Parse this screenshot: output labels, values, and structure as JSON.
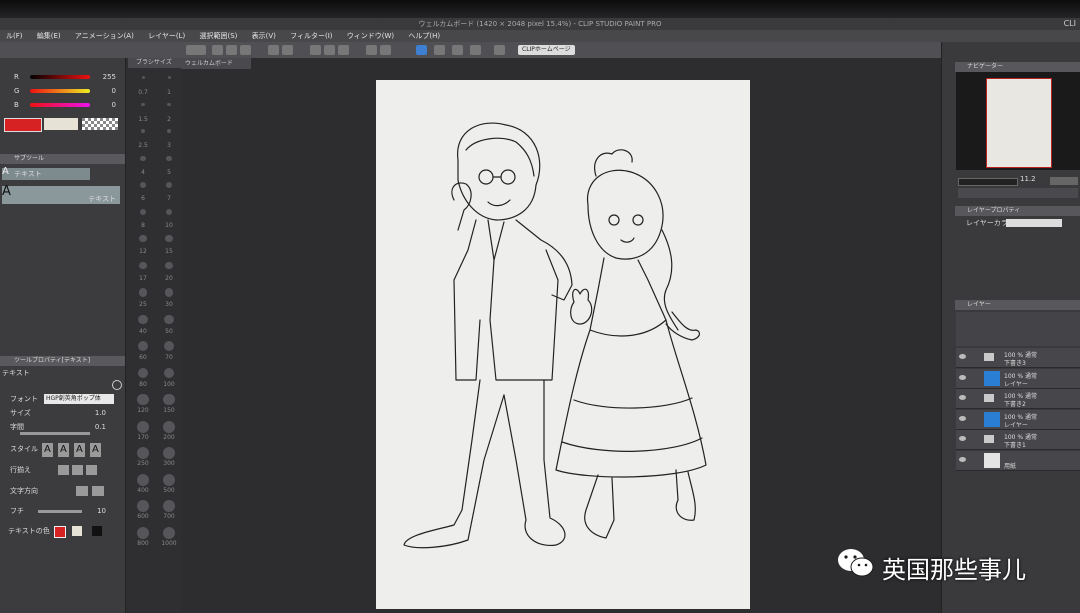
{
  "app": {
    "title": "ウェルカムボード (1420 × 2048 pixel 15.4%) - CLIP STUDIO PAINT PRO",
    "corner_brand": "CLI"
  },
  "menu": [
    "ル(F)",
    "編集(E)",
    "アニメーション(A)",
    "レイヤー(L)",
    "選択範囲(S)",
    "表示(V)",
    "フィルター(I)",
    "ウィンドウ(W)",
    "ヘルプ(H)"
  ],
  "toolbar": {
    "clip_button": "CLIPホームページ"
  },
  "color_panel": {
    "r_label": "R",
    "r_value": "255",
    "g_label": "G",
    "g_value": "0",
    "b_label": "B",
    "b_value": "0",
    "main_color": "#d62222",
    "sub_color": "#e6e2d6"
  },
  "subtool_panel": {
    "header": "サブツール",
    "tab_label": "テキスト",
    "item_label": "テキスト"
  },
  "tool_property": {
    "header": "ツールプロパティ[テキスト]",
    "title": "テキスト",
    "rows": [
      {
        "label": "フォント",
        "value": "HGP創英角ポップ体"
      },
      {
        "label": "サイズ",
        "value": "1.0"
      },
      {
        "label": "字間",
        "value": "0.1"
      },
      {
        "label": "スタイル",
        "value": ""
      },
      {
        "label": "行揃え",
        "value": ""
      },
      {
        "label": "文字方向",
        "value": ""
      },
      {
        "label": "フチ",
        "value": "10"
      },
      {
        "label": "テキストの色",
        "value": ""
      }
    ]
  },
  "swatch_tab": "ブラシサイズ",
  "brush_sizes": [
    "0.7",
    "1",
    "1.5",
    "2",
    "2.5",
    "3",
    "4",
    "5",
    "6",
    "7",
    "8",
    "10",
    "12",
    "15",
    "17",
    "20",
    "25",
    "30",
    "40",
    "50",
    "60",
    "70",
    "80",
    "100",
    "120",
    "150",
    "170",
    "200",
    "250",
    "300",
    "400",
    "500",
    "600",
    "700",
    "800",
    "1000"
  ],
  "canvas_tab": "ウェルカムボード",
  "navigator": {
    "header": "ナビゲーター",
    "zoom": "11.2"
  },
  "layer_prop": {
    "header": "レイヤープロパティ",
    "color_label": "レイヤーカラー"
  },
  "layer_panel": {
    "header": "レイヤー",
    "layers": [
      {
        "line1": "100 % 通常",
        "line2": "下書き3",
        "type": "folder"
      },
      {
        "line1": "100 % 通常",
        "line2": "レイヤー",
        "type": "blue"
      },
      {
        "line1": "100 % 通常",
        "line2": "下書き2",
        "type": "folder"
      },
      {
        "line1": "100 % 通常",
        "line2": "レイヤー",
        "type": "blue"
      },
      {
        "line1": "100 % 通常",
        "line2": "下書き1",
        "type": "folder"
      },
      {
        "line1": "",
        "line2": "用紙",
        "type": "paper"
      }
    ]
  },
  "watermark": "英国那些事儿",
  "colors": {
    "accent_red": "#d62222",
    "layer_blue": "#2a7fd4",
    "paper": "#eeeeec"
  }
}
